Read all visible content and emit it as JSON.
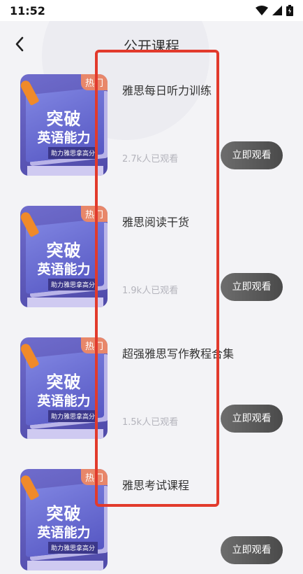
{
  "status_bar": {
    "time": "11:52"
  },
  "header": {
    "title": "公开课程"
  },
  "thumbnail": {
    "line1": "突破",
    "line2": "英语能力",
    "line3": "助力雅思拿高分",
    "badge": "热门"
  },
  "courses": [
    {
      "title": "雅思每日听力训练",
      "views": "2.7k人已观看",
      "button": "立即观看"
    },
    {
      "title": "雅思阅读干货",
      "views": "1.9k人已观看",
      "button": "立即观看"
    },
    {
      "title": "超强雅思写作教程合集",
      "views": "1.5k人已观看",
      "button": "立即观看"
    },
    {
      "title": "雅思考试课程",
      "views": "",
      "button": "立即观看"
    }
  ],
  "colors": {
    "highlight": "#e23a2c",
    "badge": "#e8876a",
    "button": "#555555"
  }
}
